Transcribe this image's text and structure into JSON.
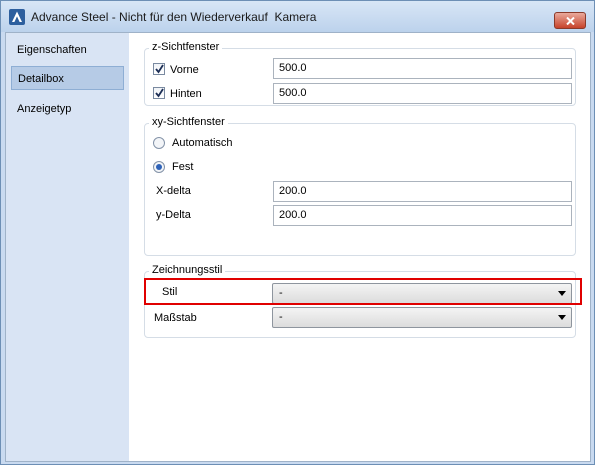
{
  "window": {
    "title": "Advance Steel - Nicht für den Wiederverkauf  Kamera"
  },
  "sidebar": {
    "items": [
      {
        "label": "Eigenschaften"
      },
      {
        "label": "Detailbox"
      },
      {
        "label": "Anzeigetyp"
      }
    ],
    "selected": "Detailbox"
  },
  "z_group": {
    "title": "z-Sichtfenster",
    "front": {
      "label": "Vorne",
      "checked": true,
      "value": "500.0"
    },
    "back": {
      "label": "Hinten",
      "checked": true,
      "value": "500.0"
    }
  },
  "xy_group": {
    "title": "xy-Sichtfenster",
    "auto_label": "Automatisch",
    "fixed_label": "Fest",
    "selected_option": "Fest",
    "x_label": "X-delta",
    "x_value": "200.0",
    "y_label": "y-Delta",
    "y_value": "200.0"
  },
  "style_group": {
    "title": "Zeichnungsstil",
    "style_label": "Stil",
    "style_value": "-",
    "scale_label": "Maßstab",
    "scale_value": "-"
  },
  "colors": {
    "highlight": "#e00000",
    "accent": "#2f63b8"
  }
}
